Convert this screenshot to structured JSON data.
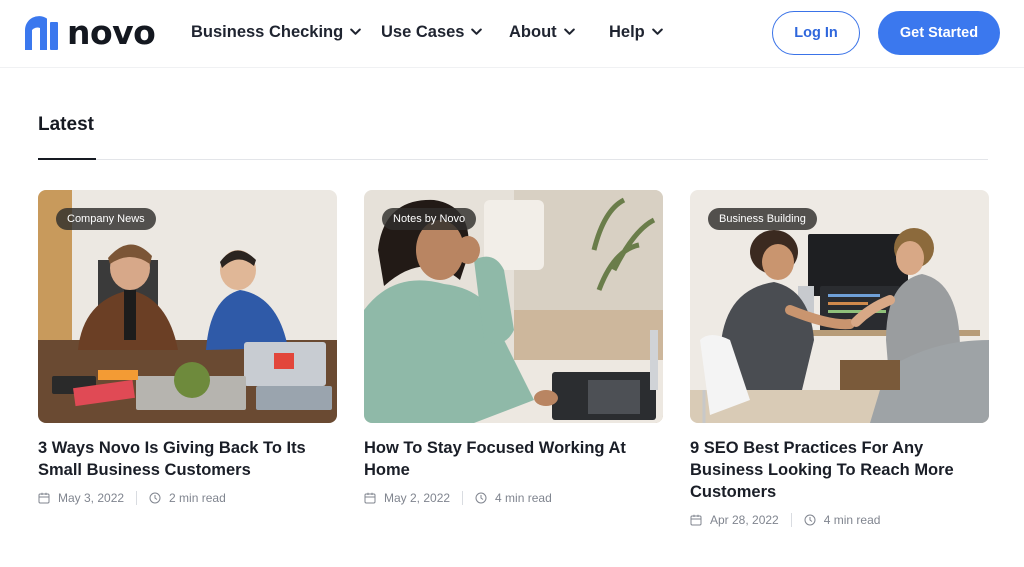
{
  "brand": {
    "name": "novo",
    "accent": "#3b78ee"
  },
  "nav": {
    "items": [
      {
        "label": "Business Checking",
        "icon": "chevron-down-icon"
      },
      {
        "label": "Use Cases",
        "icon": "chevron-down-icon"
      },
      {
        "label": "About",
        "icon": "chevron-down-icon"
      },
      {
        "label": "Help",
        "icon": "chevron-down-icon"
      }
    ],
    "login_label": "Log In",
    "start_label": "Get Started"
  },
  "section": {
    "title": "Latest"
  },
  "posts": [
    {
      "tag": "Company News",
      "title": "3 Ways Novo Is Giving Back To Its Small Business Customers",
      "date": "May 3, 2022",
      "read_time": "2 min read",
      "image": "two-men-working-on-laptop-photo"
    },
    {
      "tag": "Notes by Novo",
      "title": "How To Stay Focused Working At Home",
      "date": "May 2, 2022",
      "read_time": "4 min read",
      "image": "woman-with-laptop-on-sofa-photo"
    },
    {
      "tag": "Business Building",
      "title": "9 SEO Best Practices For Any Business Looking To Reach More Customers",
      "date": "Apr 28, 2022",
      "read_time": "4 min read",
      "image": "two-men-coding-at-desk-photo"
    }
  ]
}
